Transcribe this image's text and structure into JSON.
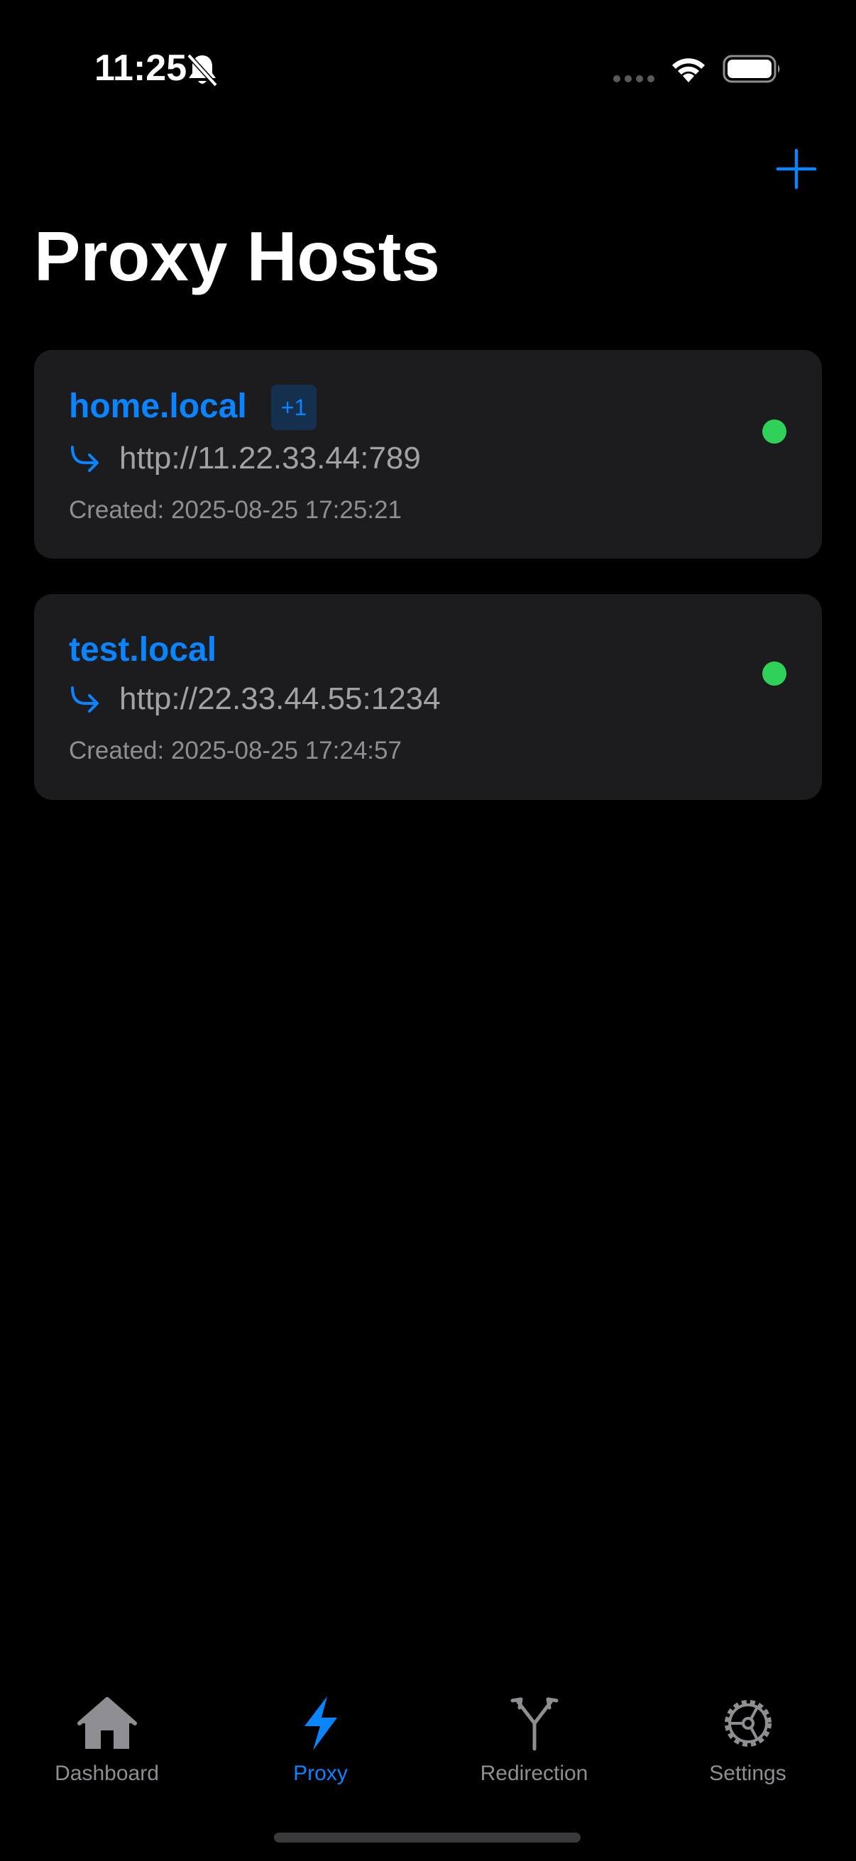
{
  "status_bar": {
    "time": "11:25",
    "icons": [
      "bell-slash-icon",
      "cellular-signal-icon",
      "wifi-icon",
      "battery-icon"
    ]
  },
  "nav": {
    "add_icon": "plus-icon",
    "title": "Proxy Hosts"
  },
  "hosts": [
    {
      "name": "home.local",
      "extra_badge": "+1",
      "target": "http://11.22.33.44:789",
      "created": "Created: 2025-08-25 17:25:21",
      "status": "online"
    },
    {
      "name": "test.local",
      "target": "http://22.33.44.55:1234",
      "created": "Created: 2025-08-25 17:24:57",
      "status": "online"
    }
  ],
  "tabs": [
    {
      "label": "Dashboard",
      "icon": "house-icon",
      "active": false
    },
    {
      "label": "Proxy",
      "icon": "bolt-icon",
      "active": true
    },
    {
      "label": "Redirection",
      "icon": "split-arrow-icon",
      "active": false
    },
    {
      "label": "Settings",
      "icon": "gear-icon",
      "active": false
    }
  ],
  "colors": {
    "accent": "#0a84ff",
    "online": "#30d158",
    "card_background": "#1c1c1e",
    "secondary_text": "#a1a1a6",
    "tab_inactive": "#8e8e93"
  }
}
